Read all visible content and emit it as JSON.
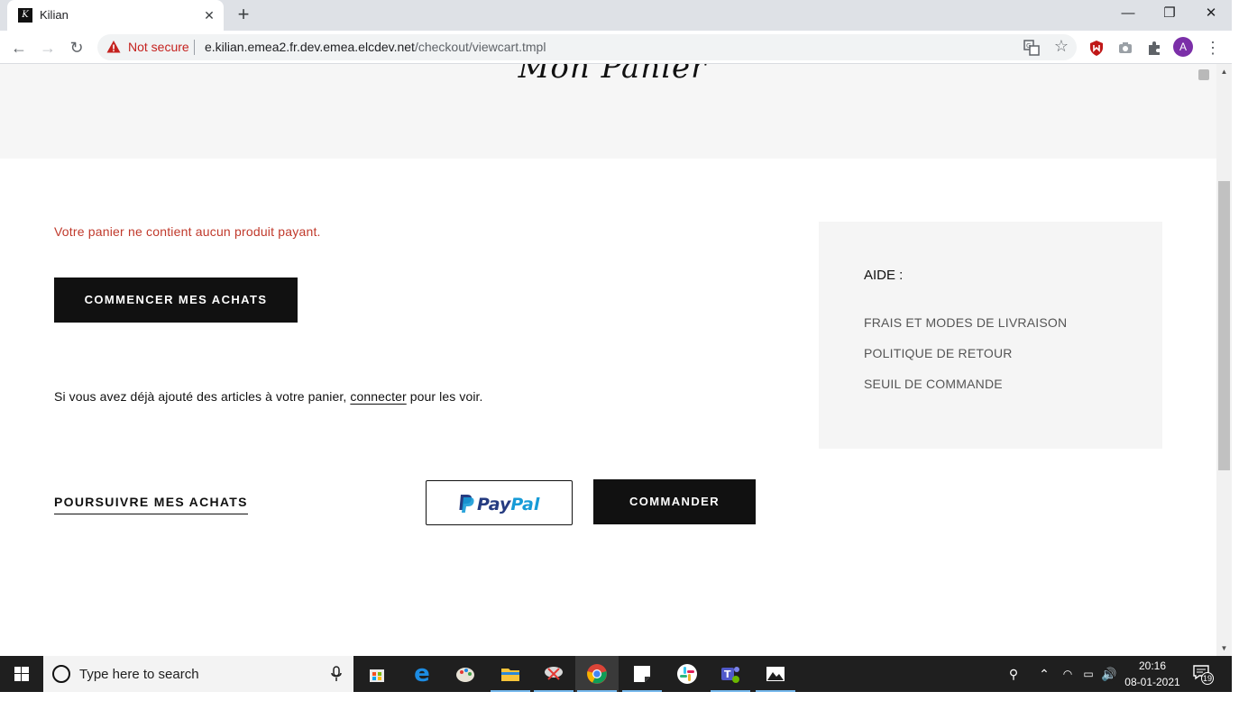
{
  "browser": {
    "tab_title": "Kilian",
    "favicon_letter": "K",
    "new_tab_symbol": "+",
    "security_label": "Not secure",
    "url_host": "e.kilian.emea2.fr.dev.emea.elcdev.net",
    "url_path": "/checkout/viewcart.tmpl",
    "profile_initial": "A",
    "window_controls": {
      "minimize": "—",
      "restore": "❐",
      "close": "✕"
    }
  },
  "page": {
    "hero_title": "Mon Panier",
    "empty_message": "Votre panier ne contient aucun produit payant.",
    "start_shopping_label": "COMMENCER MES ACHATS",
    "login_prefix": "Si vous avez déjà ajouté des articles à votre panier, ",
    "login_link": "connecter",
    "login_suffix": " pour les voir.",
    "continue_label": "POURSUIVRE MES ACHATS",
    "paypal_label": "PayPal",
    "order_label": "COMMANDER"
  },
  "help": {
    "title": "AIDE :",
    "links": [
      "FRAIS ET MODES DE LIVRAISON",
      "POLITIQUE DE RETOUR",
      "SEUIL DE COMMANDE"
    ]
  },
  "taskbar": {
    "search_placeholder": "Type here to search",
    "time": "20:16",
    "date": "08-01-2021",
    "notification_count": "19",
    "apps": [
      "store-icon",
      "edge-icon",
      "paint-icon",
      "file-explorer-icon",
      "snipping-tool-icon",
      "chrome-icon",
      "sticky-notes-icon",
      "slack-icon",
      "teams-icon",
      "photos-icon"
    ]
  },
  "colors": {
    "error_text": "#c0392b",
    "button_dark": "#111111",
    "paypal_dark_blue": "#253b80",
    "paypal_light_blue": "#179bd7",
    "help_bg": "#f5f5f5",
    "hero_bg": "#f6f6f6"
  }
}
